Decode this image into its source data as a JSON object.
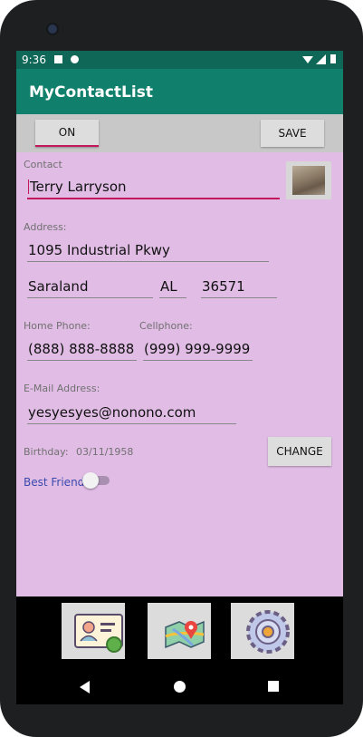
{
  "status": {
    "time": "9:36"
  },
  "app": {
    "title": "MyContactList"
  },
  "toolbar": {
    "on_label": "ON",
    "save_label": "SAVE"
  },
  "form": {
    "contact_label": "Contact",
    "contact_value": "Terry Larryson",
    "address_label": "Address:",
    "address_value": "1095 Industrial Pkwy",
    "city_value": "Saraland",
    "state_value": "AL",
    "zip_value": "36571",
    "home_phone_label": "Home Phone:",
    "home_phone_value": "(888) 888-8888",
    "cellphone_label": "Cellphone:",
    "cellphone_value": "(999) 999-9999",
    "email_label": "E-Mail Address:",
    "email_value": "yesyesyes@nonono.com",
    "birthday_label": "Birthday:",
    "birthday_value": "03/11/1958",
    "change_label": "CHANGE",
    "best_friend_label": "Best Friend",
    "best_friend_on": false
  },
  "nav": [
    {
      "name": "contact-list",
      "icon": "contact-card-icon"
    },
    {
      "name": "map",
      "icon": "map-icon"
    },
    {
      "name": "settings",
      "icon": "settings-gear-icon"
    }
  ],
  "colors": {
    "app_bar": "#10806c",
    "status_bar": "#0e6757",
    "content_bg": "#e1bde6",
    "accent": "#c2185b",
    "toolbar_bg": "#c8c8c8"
  }
}
